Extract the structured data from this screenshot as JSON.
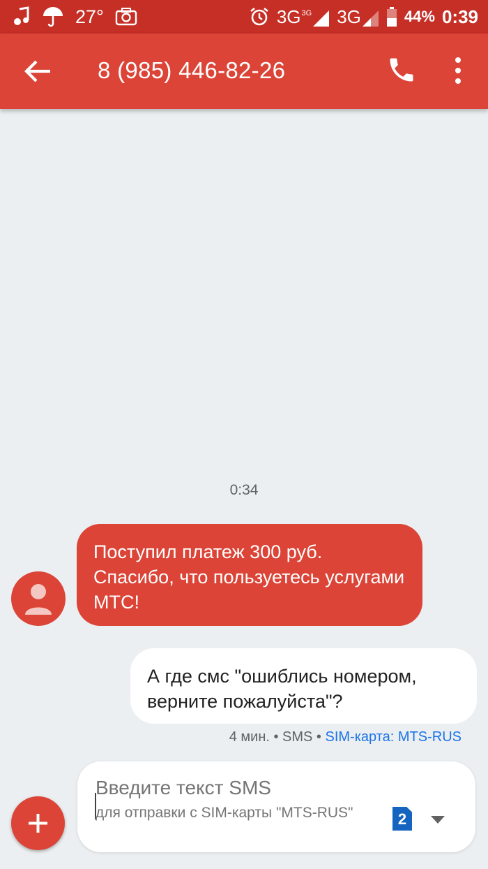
{
  "status_bar": {
    "temperature": "27°",
    "network1": "3G",
    "network1_sup": "3G",
    "network2": "3G",
    "battery_percent": "44%",
    "time": "0:39"
  },
  "header": {
    "title": "8 (985) 446-82-26"
  },
  "conversation": {
    "timestamp": "0:34",
    "incoming_message": "Поступил платеж 300 руб. Спасибо, что пользуетесь услугами МТС!",
    "outgoing_message": "А где смс \"ошиблись номером, верните пожалуйста\"?",
    "meta_time": "4 мин. • SMS •",
    "meta_sim": "SIM-карта: MTS-RUS"
  },
  "compose": {
    "placeholder": "Введите текст SMS",
    "subtext": "для отправки с SIM-карты \"MTS-RUS\"",
    "sim_number": "2"
  },
  "colors": {
    "status_bar": "#c62f26",
    "app_bar": "#db4437",
    "background": "#eceff1",
    "link": "#1a73e8",
    "sim_badge": "#1565c0"
  },
  "icons": [
    "music-note-icon",
    "umbrella-icon",
    "camera-icon",
    "alarm-icon",
    "signal-icon",
    "battery-icon",
    "back-arrow-icon",
    "phone-icon",
    "more-vert-icon",
    "person-icon",
    "plus-icon",
    "sim-card-icon",
    "dropdown-icon"
  ]
}
